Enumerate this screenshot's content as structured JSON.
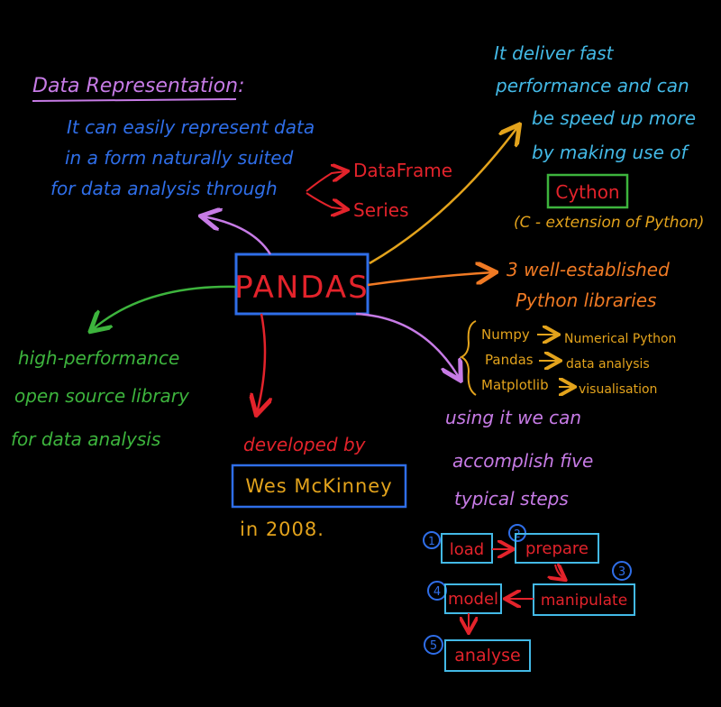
{
  "colors": {
    "background": "#000000",
    "purple": "#c77be6",
    "blue": "#2f6ee8",
    "red": "#e3232b",
    "yellow": "#e3a31c",
    "cyan": "#43b9e6",
    "green": "#3db43d",
    "orange": "#f07a24"
  },
  "center": {
    "label": "PANDAS"
  },
  "data_representation": {
    "heading": "Data Representation:",
    "line1": "It can easily represent data",
    "line2": "in a form naturally suited",
    "line3": "for data analysis through",
    "dataframe": "DataFrame",
    "series": "Series"
  },
  "performance": {
    "line1": "It deliver fast",
    "line2": "performance and can",
    "line3": "be speed up more",
    "line4": "by making use of",
    "cython": "Cython",
    "cython_note": "(C - extension of Python)"
  },
  "libraries": {
    "line1": "3 well-established",
    "line2": "Python libraries",
    "items": [
      {
        "name": "Numpy",
        "desc": "Numerical Python"
      },
      {
        "name": "Pandas",
        "desc": "data analysis"
      },
      {
        "name": "Matplotlib",
        "desc": "visualisation"
      }
    ]
  },
  "steps_intro": {
    "line1": "using it we can",
    "line2": "accomplish five",
    "line3": "typical steps"
  },
  "steps": [
    {
      "number": "1",
      "label": "load"
    },
    {
      "number": "2",
      "label": "prepare"
    },
    {
      "number": "3",
      "label": "manipulate"
    },
    {
      "number": "4",
      "label": "model"
    },
    {
      "number": "5",
      "label": "analyse"
    }
  ],
  "open_source": {
    "line1": "high-performance",
    "line2": "open source library",
    "line3": "for data analysis"
  },
  "developer": {
    "line1": "developed by",
    "name": "Wes McKinney",
    "line3": "in 2008."
  }
}
